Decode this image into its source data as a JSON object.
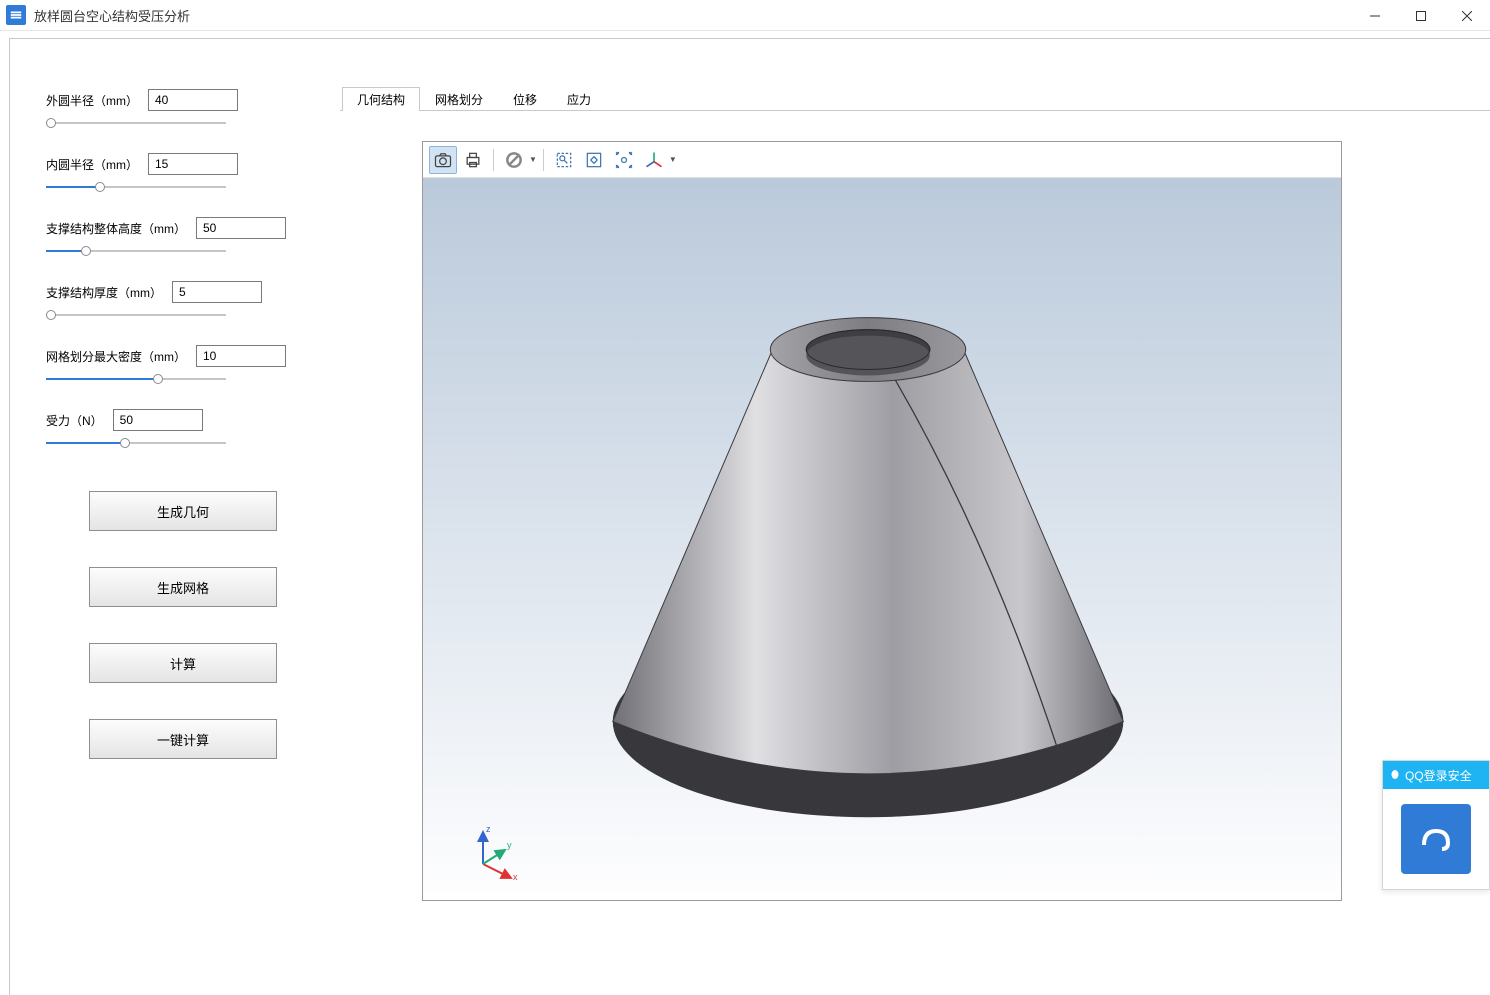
{
  "titlebar": {
    "title": "放样圆台空心结构受压分析"
  },
  "sidebar": {
    "params": [
      {
        "label": "外圆半径（mm）",
        "value": "40",
        "fill": 3
      },
      {
        "label": "内圆半径（mm）",
        "value": "15",
        "fill": 30
      },
      {
        "label": "支撑结构整体高度（mm）",
        "value": "50",
        "fill": 22
      },
      {
        "label": "支撑结构厚度（mm）",
        "value": "5",
        "fill": 3
      },
      {
        "label": "网格划分最大密度（mm）",
        "value": "10",
        "fill": 62
      },
      {
        "label": "受力（N）",
        "value": "50",
        "fill": 44
      }
    ],
    "buttons": {
      "gen_geom": "生成几何",
      "gen_mesh": "生成网格",
      "calc": "计算",
      "one_click": "一键计算"
    }
  },
  "main": {
    "tabs": [
      {
        "label": "几何结构",
        "active": true
      },
      {
        "label": "网格划分",
        "active": false
      },
      {
        "label": "位移",
        "active": false
      },
      {
        "label": "应力",
        "active": false
      }
    ],
    "toolbar_icons": {
      "snapshot": "camera-icon",
      "print": "print-icon",
      "clear": "no-entry-icon",
      "zoom_box": "zoom-box-icon",
      "fit": "fit-icon",
      "fit_all": "fit-all-icon",
      "axes": "axes-icon"
    }
  },
  "qq": {
    "header": "QQ登录安全"
  },
  "axis_labels": {
    "x": "x",
    "y": "y",
    "z": "z"
  }
}
